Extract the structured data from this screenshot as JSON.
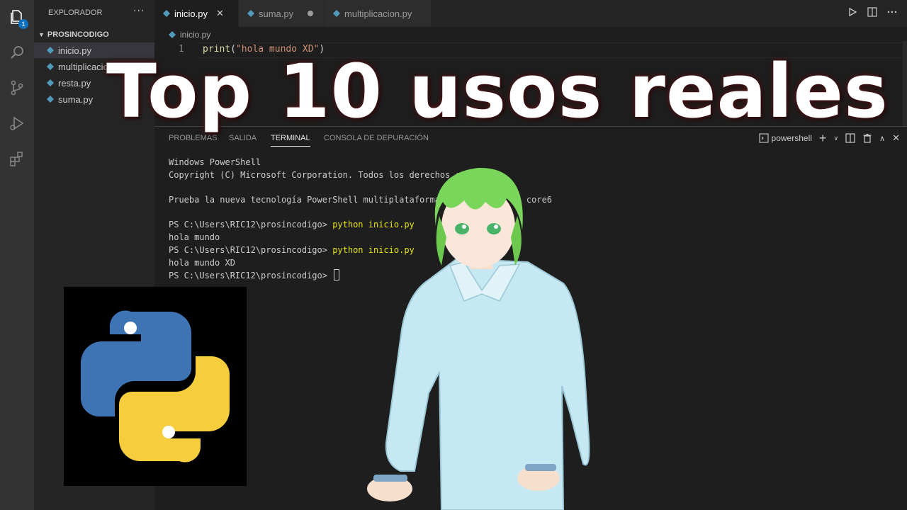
{
  "sidebar": {
    "header": "EXPLORADOR",
    "more": "···",
    "folder": "PROSINCODIGO",
    "files": [
      {
        "label": "inicio.py"
      },
      {
        "label": "multiplicacion.py"
      },
      {
        "label": "resta.py"
      },
      {
        "label": "suma.py"
      }
    ],
    "badge": "1"
  },
  "tabs": [
    {
      "label": "inicio.py",
      "close": "✕"
    },
    {
      "label": "suma.py"
    },
    {
      "label": "multiplicacion.py"
    }
  ],
  "editor": {
    "breadcrumb": "inicio.py",
    "line_number": "1",
    "code_fn": "print",
    "code_open": "(",
    "code_str": "\"hola mundo XD\"",
    "code_close": ")"
  },
  "panel": {
    "tabs": [
      "PROBLEMAS",
      "SALIDA",
      "TERMINAL",
      "CONSOLA DE DEPURACIÓN"
    ],
    "active_tab": "TERMINAL",
    "shell": "powershell",
    "terminal": {
      "l1": "Windows PowerShell",
      "l2": "Copyright (C) Microsoft Corporation. Todos los derechos r",
      "l3": "Prueba la nueva tecnología PowerShell multiplataforma",
      "l3b": "core6",
      "prompt": "PS C:\\Users\\RIC12\\prosincodigo> ",
      "cmd": "python inicio.py",
      "out1": "hola mundo",
      "out2": "hola mundo XD"
    }
  },
  "overlay": {
    "headline": "Top 10 usos reales"
  },
  "colors": {
    "python_blue": "#3e74b4",
    "python_yellow": "#f6cd3c",
    "avatar_hair": "#7ad65a",
    "avatar_shirt": "#c6e8f2"
  }
}
